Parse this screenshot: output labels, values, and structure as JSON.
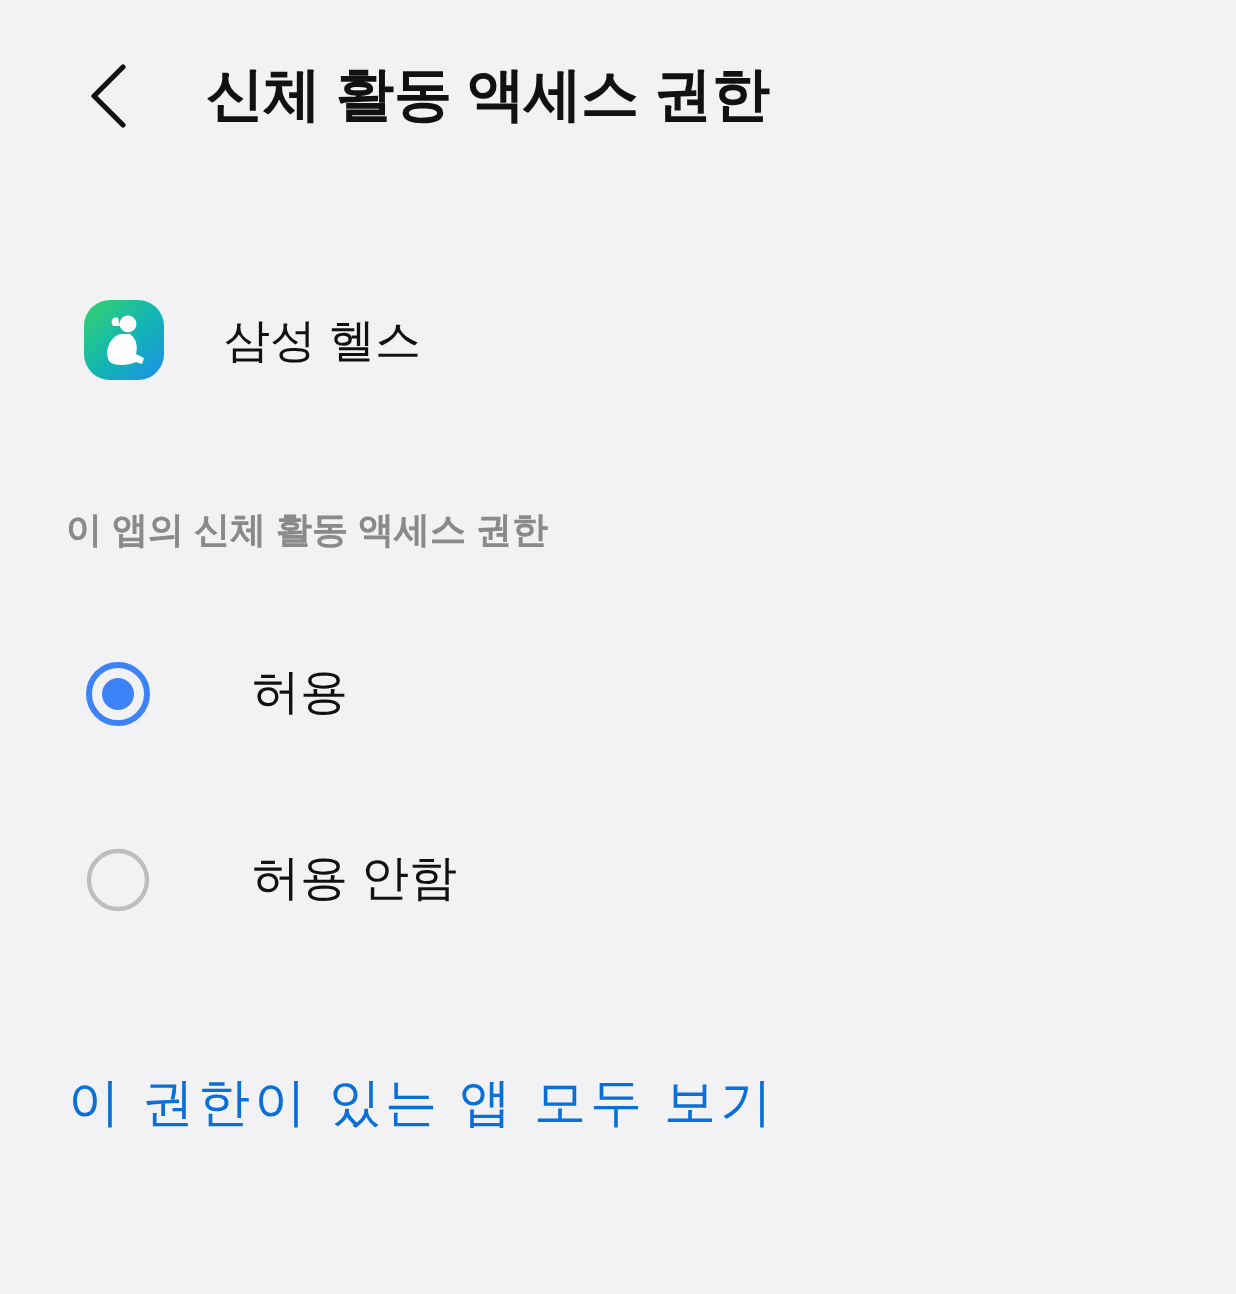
{
  "header": {
    "title": "신체 활동 액세스 권한"
  },
  "app": {
    "name": "삼성 헬스"
  },
  "section": {
    "title": "이 앱의 신체 활동 액세스 권한"
  },
  "options": [
    {
      "label": "허용",
      "selected": true
    },
    {
      "label": "허용 안함",
      "selected": false
    }
  ],
  "link": {
    "label": "이 권한이 있는 앱 모두 보기"
  }
}
